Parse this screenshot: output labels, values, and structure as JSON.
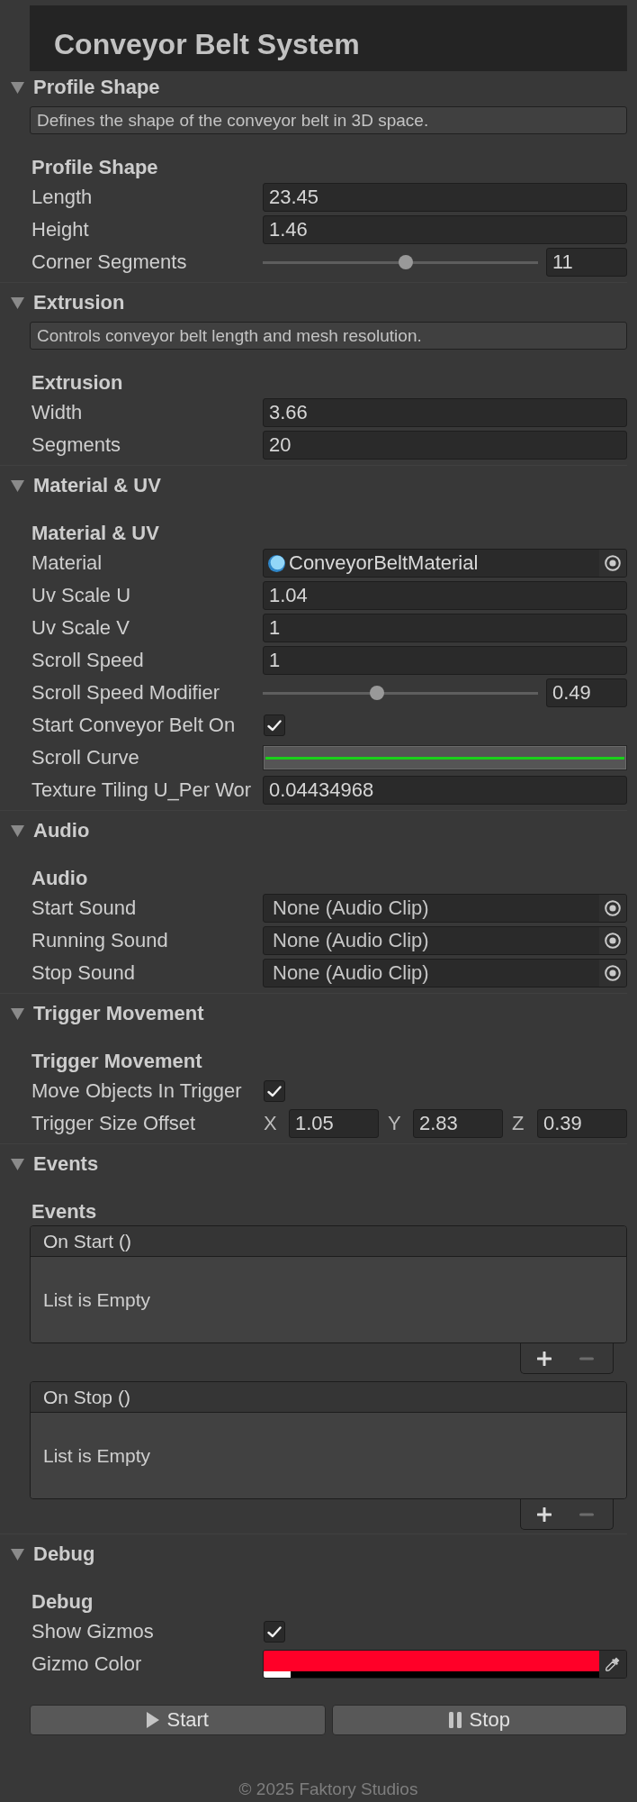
{
  "title": "Conveyor Belt System",
  "sections": [
    {
      "title": "Profile Shape",
      "expanded": true,
      "help": "Defines the shape of the conveyor belt in 3D space.",
      "group": "Profile Shape",
      "fields": [
        {
          "kind": "number",
          "label": "Length",
          "value": "23.45"
        },
        {
          "kind": "number",
          "label": "Height",
          "value": "1.46"
        },
        {
          "kind": "slider",
          "label": "Corner Segments",
          "level": 0.52,
          "value": "11"
        }
      ]
    },
    {
      "title": "Extrusion",
      "expanded": true,
      "help": "Controls conveyor belt length and mesh resolution.",
      "group": "Extrusion",
      "fields": [
        {
          "kind": "number",
          "label": "Width",
          "value": "3.66"
        },
        {
          "kind": "number",
          "label": "Segments",
          "value": "20"
        }
      ]
    },
    {
      "title": "Material & UV",
      "expanded": true,
      "group": "Material & UV",
      "fields": [
        {
          "kind": "object",
          "label": "Material",
          "value": "ConveyorBeltMaterial",
          "assigned": true
        },
        {
          "kind": "number",
          "label": "Uv Scale U",
          "value": "1.04"
        },
        {
          "kind": "number",
          "label": "Uv Scale V",
          "value": "1"
        },
        {
          "kind": "number",
          "label": "Scroll Speed",
          "value": "1"
        },
        {
          "kind": "slider",
          "label": "Scroll Speed Modifier",
          "level": 0.41,
          "value": "0.49"
        },
        {
          "kind": "toggle",
          "label": "Start Conveyor Belt On",
          "checked": true
        },
        {
          "kind": "curve",
          "label": "Scroll Curve"
        },
        {
          "kind": "number",
          "label": "Texture Tiling U_Per Wor",
          "value": "0.04434968"
        }
      ]
    },
    {
      "title": "Audio",
      "expanded": true,
      "group": "Audio",
      "fields": [
        {
          "kind": "object",
          "label": "Start Sound",
          "value": "None (Audio Clip)",
          "assigned": false
        },
        {
          "kind": "object",
          "label": "Running Sound",
          "value": "None (Audio Clip)",
          "assigned": false
        },
        {
          "kind": "object",
          "label": "Stop Sound",
          "value": "None (Audio Clip)",
          "assigned": false
        }
      ]
    },
    {
      "title": "Trigger Movement",
      "expanded": true,
      "group": "Trigger Movement",
      "fields": [
        {
          "kind": "toggle",
          "label": "Move Objects In Trigger",
          "checked": true
        },
        {
          "kind": "vector",
          "label": "Trigger Size Offset",
          "components": [
            {
              "axis": "X",
              "value": "1.05"
            },
            {
              "axis": "Y",
              "value": "2.83"
            },
            {
              "axis": "Z",
              "value": "0.39"
            }
          ]
        }
      ]
    },
    {
      "title": "Events",
      "expanded": true,
      "group": "Events",
      "fields": [
        {
          "kind": "event",
          "title": "On Start ()",
          "empty_text": "List is Empty",
          "can_remove": false
        },
        {
          "kind": "event",
          "title": "On Stop ()",
          "empty_text": "List is Empty",
          "can_remove": false
        }
      ]
    },
    {
      "title": "Debug",
      "expanded": true,
      "group": "Debug",
      "fields": [
        {
          "kind": "toggle",
          "label": "Show Gizmos",
          "checked": true
        },
        {
          "kind": "color",
          "label": "Gizmo Color",
          "color": "#ff0028",
          "level": 0.08
        }
      ]
    }
  ],
  "buttons": [
    {
      "kind": "play",
      "label": "Start"
    },
    {
      "kind": "pause",
      "label": "Stop"
    }
  ],
  "footer": "© 2025 Faktory Studios"
}
